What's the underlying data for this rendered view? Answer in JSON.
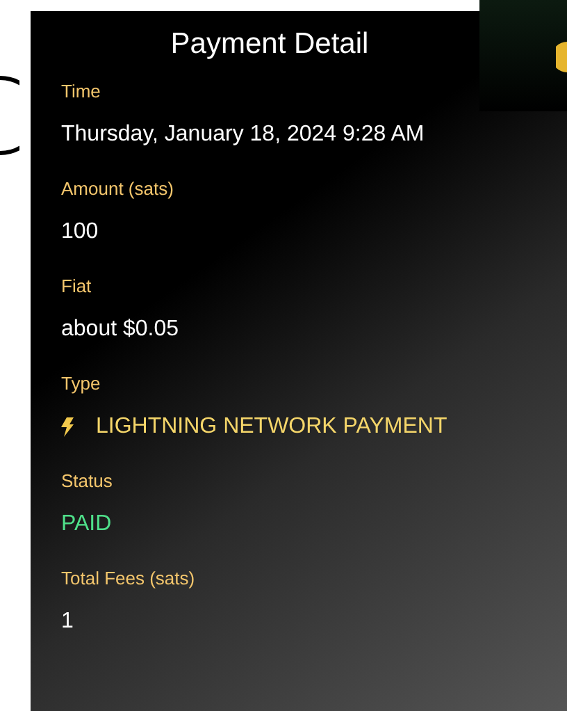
{
  "title": "Payment Detail",
  "fields": [
    {
      "label": "Time",
      "value": "Thursday, January 18, 2024 9:28 AM",
      "kind": "text"
    },
    {
      "label": "Amount (sats)",
      "value": "100",
      "kind": "text"
    },
    {
      "label": "Fiat",
      "value": "about $0.05",
      "kind": "text"
    },
    {
      "label": "Type",
      "value": "LIGHTNING NETWORK PAYMENT",
      "kind": "type"
    },
    {
      "label": "Status",
      "value": "PAID",
      "kind": "status"
    },
    {
      "label": "Total Fees (sats)",
      "value": "1",
      "kind": "text"
    }
  ]
}
